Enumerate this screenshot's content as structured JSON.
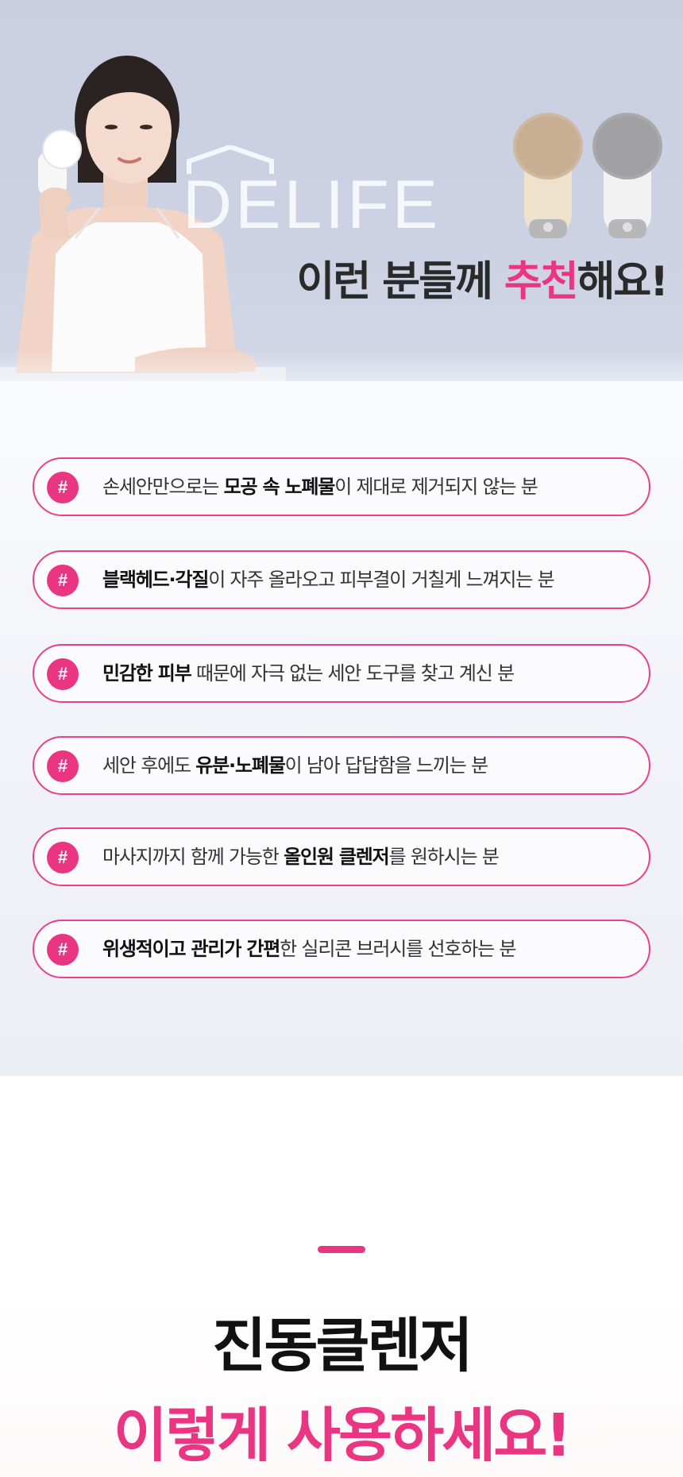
{
  "hero": {
    "brand_logo": "DELIFE",
    "headline_part1": "이런 분들께 ",
    "headline_accent": "추천",
    "headline_part2": "해요!",
    "accent_color": "#ea3583",
    "device_colors": [
      "beige",
      "gray"
    ]
  },
  "recommendations": [
    {
      "icon": "#",
      "pre": "손세안만으로는 ",
      "bold": "모공 속 노폐물",
      "post": "이 제대로 제거되지 않는 분"
    },
    {
      "icon": "#",
      "pre": "",
      "bold": "블랙헤드·각질",
      "post": "이 자주 올라오고 피부결이 거칠게 느껴지는 분"
    },
    {
      "icon": "#",
      "pre": "",
      "bold": "민감한 피부",
      "post": " 때문에 자극 없는 세안 도구를 찾고 계신 분"
    },
    {
      "icon": "#",
      "pre": "세안 후에도 ",
      "bold": "유분·노폐물",
      "post": "이 남아 답답함을 느끼는 분"
    },
    {
      "icon": "#",
      "pre": "마사지까지 함께 가능한 ",
      "bold": "올인원 클렌저",
      "post": "를 원하시는 분"
    },
    {
      "icon": "#",
      "pre": "",
      "bold": "위생적이고 관리가 간편",
      "post": "한 실리콘 브러시를 선호하는 분"
    }
  ],
  "usage": {
    "title": "진동클렌저",
    "subtitle": "이렇게 사용하세요!"
  }
}
